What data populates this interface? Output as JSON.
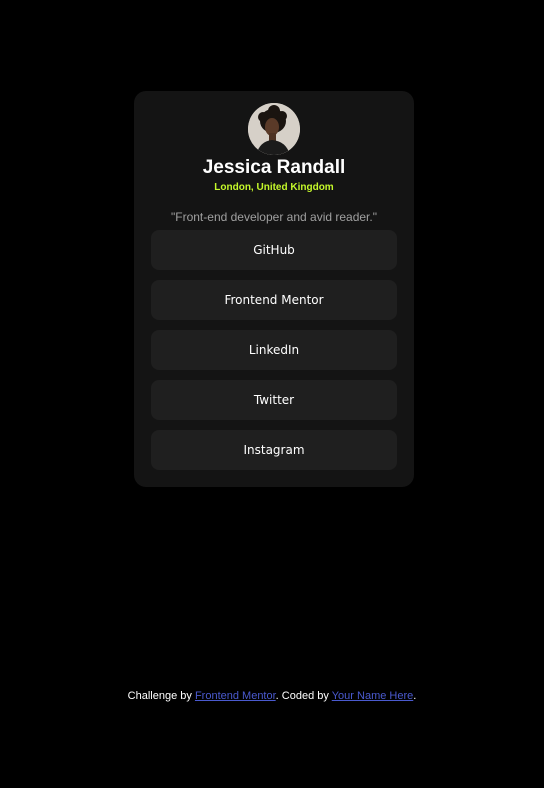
{
  "profile": {
    "name": "Jessica Randall",
    "location": "London, United Kingdom",
    "bio": "\"Front-end developer and avid reader.\"",
    "avatar_icon": "profile-photo"
  },
  "links": [
    {
      "label": "GitHub"
    },
    {
      "label": "Frontend Mentor"
    },
    {
      "label": "LinkedIn"
    },
    {
      "label": "Twitter"
    },
    {
      "label": "Instagram"
    }
  ],
  "footer": {
    "prefix": "Challenge by ",
    "challenge_link": "Frontend Mentor",
    "middle": ". Coded by ",
    "author_link": "Your Name Here",
    "suffix": "."
  },
  "colors": {
    "background": "#000000",
    "card": "#141414",
    "button": "#1f1f1f",
    "accent": "#c4f82a",
    "muted_text": "#a0a0a0",
    "footer_link": "#4a5acf"
  }
}
